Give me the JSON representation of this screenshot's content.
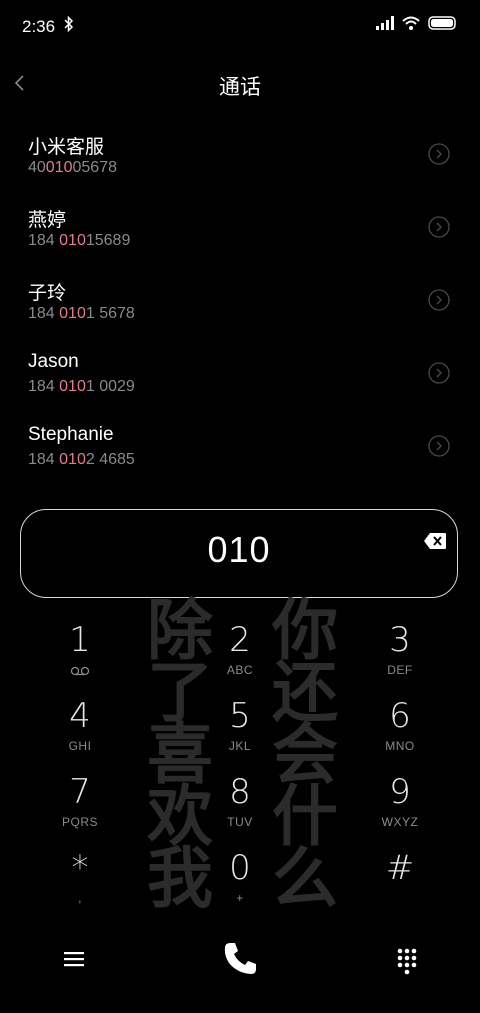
{
  "status_bar": {
    "time": "2:36",
    "icons": [
      "bluetooth-icon",
      "signal-icon",
      "wifi-icon",
      "battery-icon"
    ]
  },
  "header": {
    "title": "通话",
    "back_icon": "chevron-left-icon"
  },
  "contacts": [
    {
      "name": "小米客服",
      "number_pre": "40",
      "number_hl": "010",
      "number_post": "05678"
    },
    {
      "name": "燕婷",
      "number_pre": "184 ",
      "number_hl": "010",
      "number_post": "15689"
    },
    {
      "name": "子玲",
      "number_pre": "184 ",
      "number_hl": "010",
      "number_post": "1 5678"
    },
    {
      "name": "Jason",
      "number_pre": "184 ",
      "number_hl": "010",
      "number_post": "1 0029"
    },
    {
      "name": "Stephanie",
      "number_pre": "184 ",
      "number_hl": "010",
      "number_post": "2 4685"
    }
  ],
  "dial": {
    "entered": "010"
  },
  "watermark": {
    "left": [
      "除",
      "了",
      "喜",
      "欢",
      "我"
    ],
    "right": [
      "你",
      "还",
      "会",
      "什",
      "么"
    ]
  },
  "keypad": [
    {
      "digit": "1",
      "letters": ""
    },
    {
      "digit": "2",
      "letters": "ABC"
    },
    {
      "digit": "3",
      "letters": "DEF"
    },
    {
      "digit": "4",
      "letters": "GHI"
    },
    {
      "digit": "5",
      "letters": "JKL"
    },
    {
      "digit": "6",
      "letters": "MNO"
    },
    {
      "digit": "7",
      "letters": "PQRS"
    },
    {
      "digit": "8",
      "letters": "TUV"
    },
    {
      "digit": "9",
      "letters": "WXYZ"
    },
    {
      "digit": "*",
      "letters": ","
    },
    {
      "digit": "0",
      "letters": "+"
    },
    {
      "digit": "#",
      "letters": ""
    }
  ],
  "colors": {
    "background": "#000000",
    "highlight": "#e87b8b",
    "secondary_text": "#8a8a8a",
    "accent": "#ffffff"
  }
}
